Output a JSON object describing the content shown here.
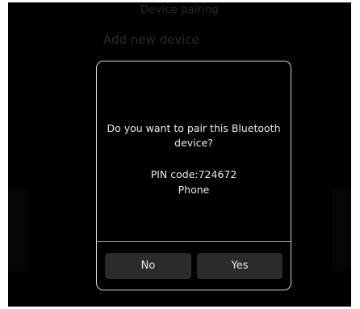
{
  "header": {
    "title": "Device pairing"
  },
  "background": {
    "section_title": "Add new device"
  },
  "dialog": {
    "message": "Do you want to pair this Bluetooth device?",
    "pin_label": "PIN code:",
    "pin_value": "724672",
    "device_name": "Phone",
    "no_label": "No",
    "yes_label": "Yes"
  },
  "colors": {
    "screen_background": "#000000",
    "dialog_border": "#d4d4d4",
    "button_background": "#2b2b2b",
    "text": "#ececec"
  }
}
